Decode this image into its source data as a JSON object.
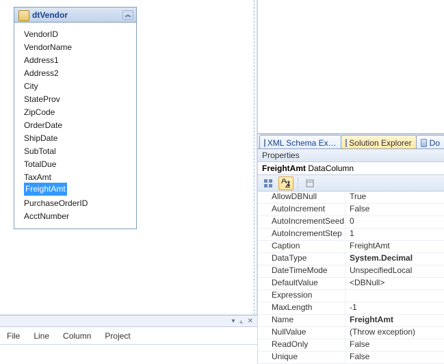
{
  "table": {
    "name": "dtVendor",
    "columns": [
      "VendorID",
      "VendorName",
      "Address1",
      "Address2",
      "City",
      "StateProv",
      "ZipCode",
      "OrderDate",
      "ShipDate",
      "SubTotal",
      "TotalDue",
      "TaxAmt",
      "FreightAmt",
      "PurchaseOrderID",
      "AcctNumber"
    ],
    "selected_index": 12
  },
  "error_list": {
    "headers": [
      "File",
      "Line",
      "Column",
      "Project"
    ]
  },
  "tabs": {
    "items": [
      {
        "label": "XML Schema Ex…",
        "active": false
      },
      {
        "label": "Solution Explorer",
        "active": true
      },
      {
        "label": "Do",
        "active": false
      }
    ]
  },
  "properties": {
    "panel_title": "Properties",
    "object_name": "FreightAmt",
    "object_type": "DataColumn",
    "rows": [
      {
        "name": "AllowDBNull",
        "value": "True"
      },
      {
        "name": "AutoIncrement",
        "value": "False"
      },
      {
        "name": "AutoIncrementSeed",
        "value": "0"
      },
      {
        "name": "AutoIncrementStep",
        "value": "1"
      },
      {
        "name": "Caption",
        "value": "FreightAmt"
      },
      {
        "name": "DataType",
        "value": "System.Decimal",
        "bold": true
      },
      {
        "name": "DateTimeMode",
        "value": "UnspecifiedLocal"
      },
      {
        "name": "DefaultValue",
        "value": "<DBNull>"
      },
      {
        "name": "Expression",
        "value": ""
      },
      {
        "name": "MaxLength",
        "value": "-1"
      },
      {
        "name": "Name",
        "value": "FreightAmt",
        "bold": true
      },
      {
        "name": "NullValue",
        "value": "(Throw exception)"
      },
      {
        "name": "ReadOnly",
        "value": "False"
      },
      {
        "name": "Unique",
        "value": "False"
      }
    ]
  }
}
